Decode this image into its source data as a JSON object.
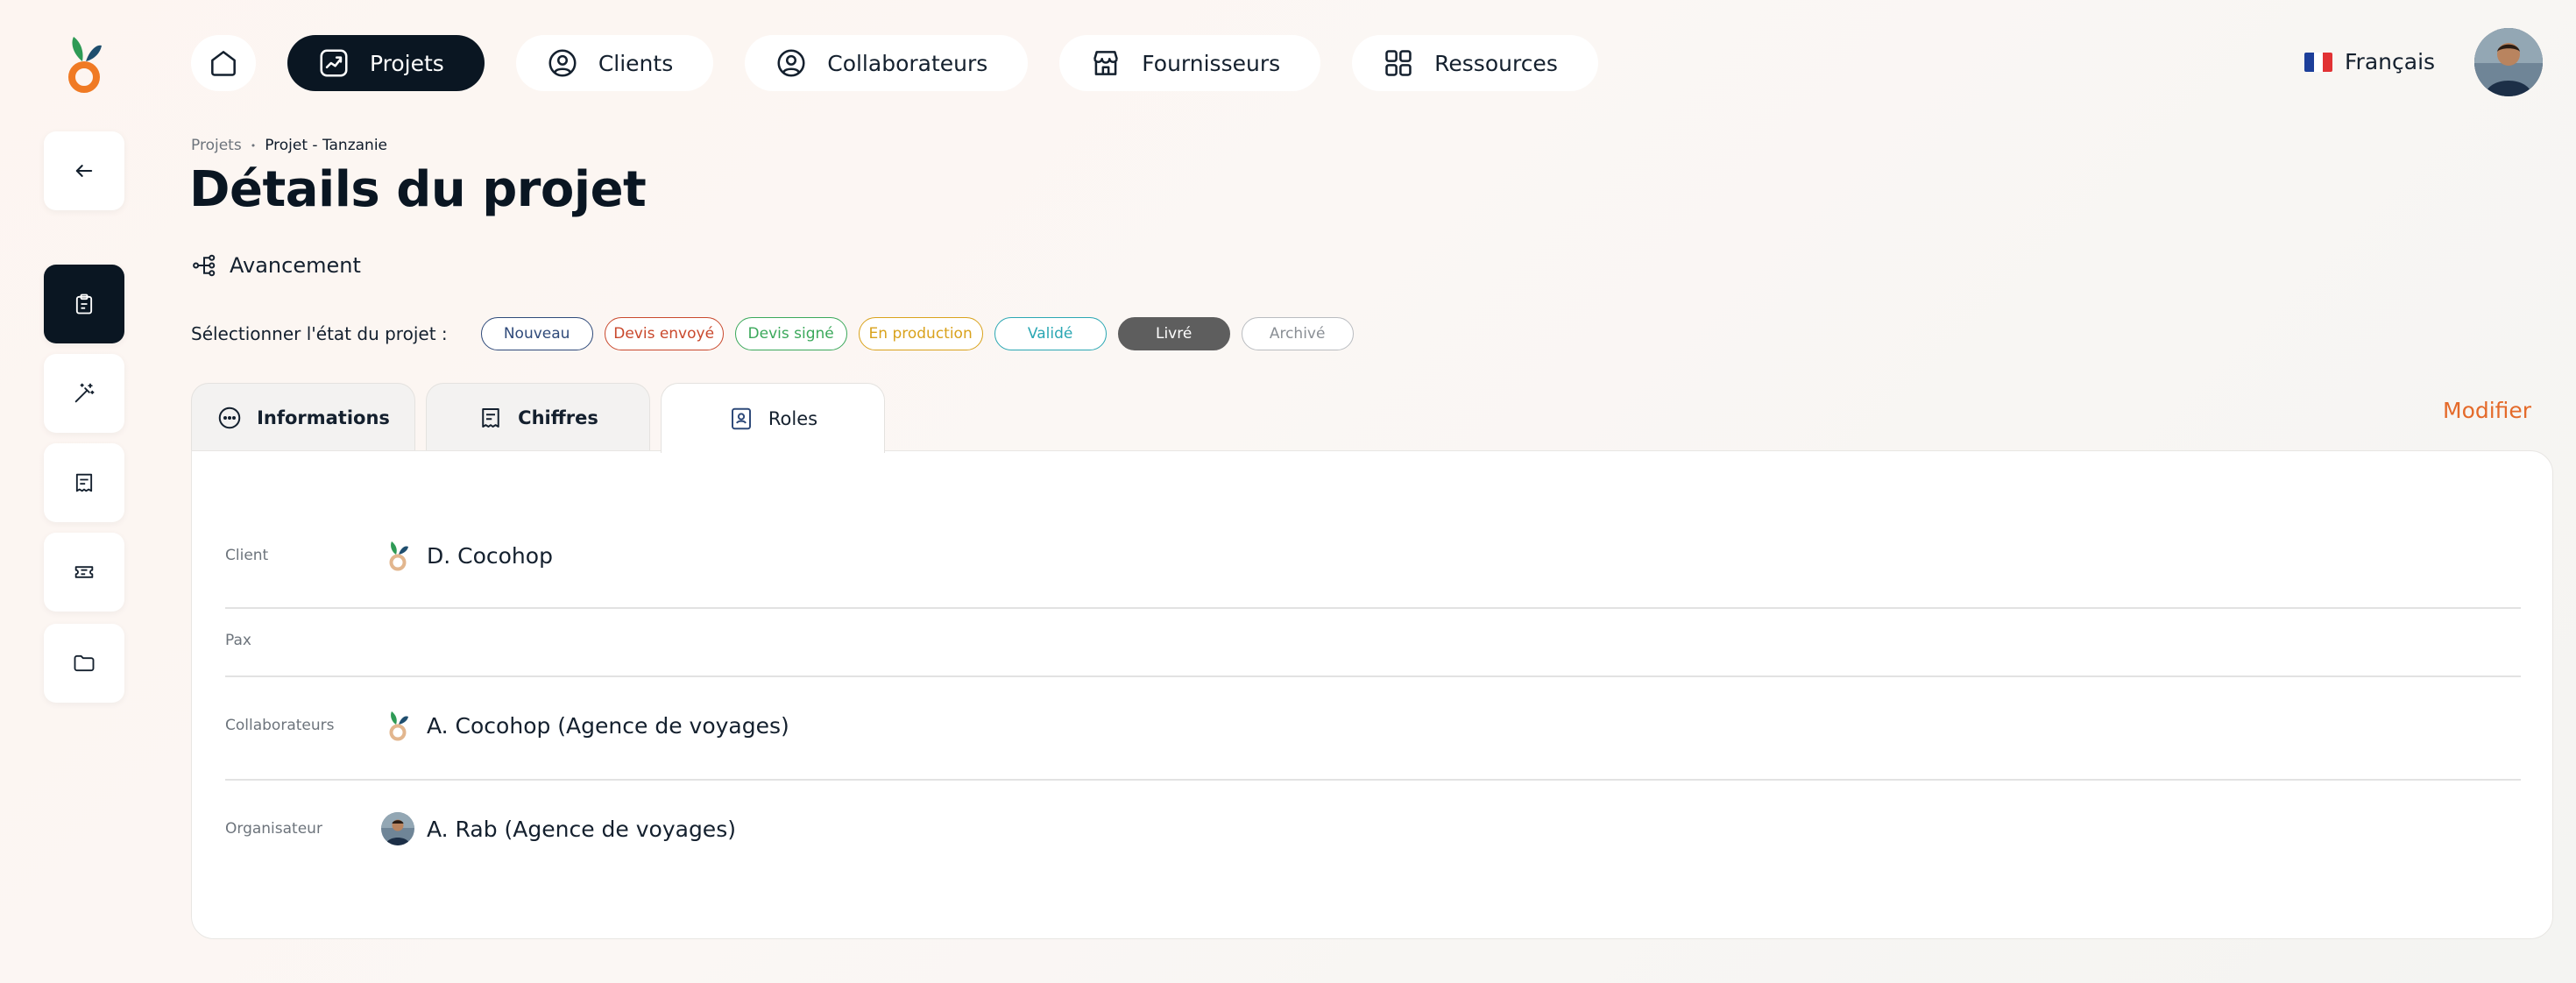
{
  "nav": {
    "items": [
      {
        "key": "home",
        "label": "",
        "icon": "home-icon"
      },
      {
        "key": "projets",
        "label": "Projets",
        "icon": "projects-icon",
        "active": true
      },
      {
        "key": "clients",
        "label": "Clients",
        "icon": "user-circle-icon"
      },
      {
        "key": "collaborateurs",
        "label": "Collaborateurs",
        "icon": "user-circle-icon"
      },
      {
        "key": "fournisseurs",
        "label": "Fournisseurs",
        "icon": "storefront-icon"
      },
      {
        "key": "ressources",
        "label": "Ressources",
        "icon": "grid-icon"
      }
    ],
    "language": "Français"
  },
  "breadcrumb": {
    "parent": "Projets",
    "separator": "•",
    "current": "Projet - Tanzanie"
  },
  "page_title": "Détails du projet",
  "progress": {
    "title": "Avancement"
  },
  "states": {
    "label": "Sélectionner l'état du projet :",
    "items": [
      {
        "label": "Nouveau",
        "color": "#2f4a7a"
      },
      {
        "label": "Devis envoyé",
        "color": "#c9482c"
      },
      {
        "label": "Devis signé",
        "color": "#3aa85a"
      },
      {
        "label": "En production",
        "color": "#d9a21c"
      },
      {
        "label": "Validé",
        "color": "#2aa7b3"
      },
      {
        "label": "Livré",
        "color": "#5e5e5e",
        "active": true
      },
      {
        "label": "Archivé",
        "color": "#8a8f95"
      }
    ]
  },
  "tabs": [
    {
      "label": "Informations",
      "icon": "dots-circle-icon"
    },
    {
      "label": "Chiffres",
      "icon": "receipt-icon"
    },
    {
      "label": "Roles",
      "icon": "id-badge-icon",
      "active": true
    }
  ],
  "actions": {
    "modify": "Modifier"
  },
  "roles": [
    {
      "label": "Client",
      "value": "D. Cocohop",
      "avatar": "cocohop-logo"
    },
    {
      "label": "Pax",
      "value": ""
    },
    {
      "label": "Collaborateurs",
      "value": "A. Cocohop (Agence de voyages)",
      "avatar": "cocohop-logo"
    },
    {
      "label": "Organisateur",
      "value": "A. Rab (Agence de voyages)",
      "avatar": "user-photo"
    }
  ],
  "colors": {
    "brand_dark": "#0a1622",
    "accent_orange": "#e46a2a",
    "logo_green": "#3aa85a"
  }
}
